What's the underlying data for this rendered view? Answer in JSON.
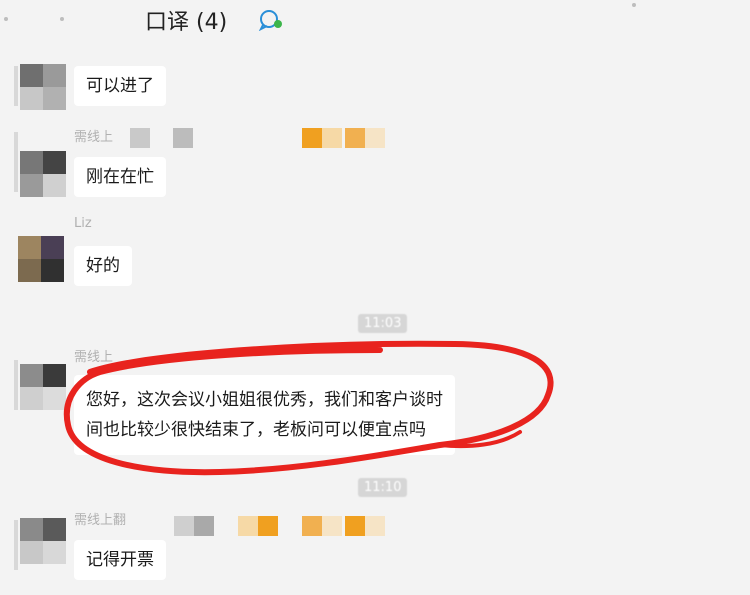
{
  "chat_title": "口译 (4)",
  "messages": [
    {
      "sender": "",
      "text": "可以进了"
    },
    {
      "sender": "需线上",
      "text": "刚在在忙"
    },
    {
      "sender": "Liz",
      "text": "好的"
    },
    {
      "time": "11:03"
    },
    {
      "sender": "需线上",
      "text_lines": [
        "您好，这次会议小姐姐很优秀，我们和客户谈时",
        "间也比较少很快结束了，老板问可以便宜点吗"
      ]
    },
    {
      "time": "11:10"
    },
    {
      "sender": "需线上翻",
      "text": "记得开票"
    }
  ],
  "colors": {
    "highlight_circle": "#e8231e",
    "blur_orange": "#f0a020",
    "blur_gray": "#bdbdbd"
  }
}
